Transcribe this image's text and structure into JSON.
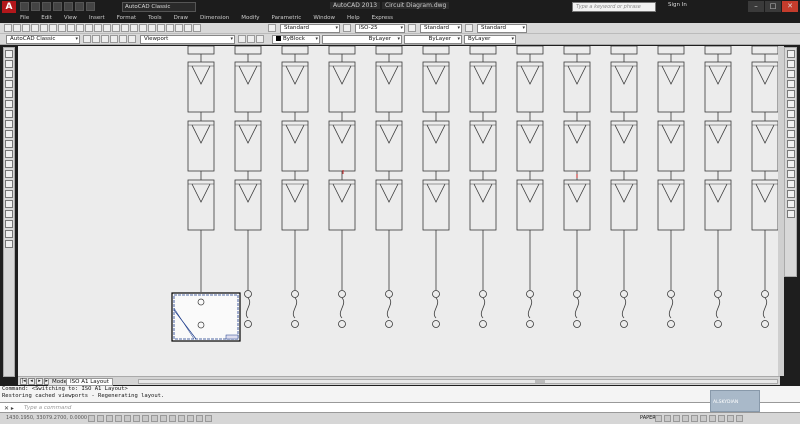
{
  "window": {
    "title_app": "AutoCAD 2013",
    "title_file": "Circuit Diagram.dwg",
    "workspace": "AutoCAD Classic",
    "search_placeholder": "Type a keyword or phrase",
    "signin": "Sign In"
  },
  "menu": [
    "File",
    "Edit",
    "View",
    "Insert",
    "Format",
    "Tools",
    "Draw",
    "Dimension",
    "Modify",
    "Parametric",
    "Window",
    "Help",
    "Express"
  ],
  "toolbar1": {
    "text_style": "Standard",
    "dim_style": "ISO-25",
    "table_style": "Standard",
    "mleader_style": "Standard"
  },
  "toolbar2": {
    "workspace": "AutoCAD Classic",
    "layer": "Viewport",
    "color": "ByBlock",
    "linetype": "ByLayer",
    "lineweight": "ByLayer",
    "plotstyle": "ByLayer"
  },
  "layout_tabs": [
    "Model",
    "ISO A1 Layout"
  ],
  "command_history": [
    "Command:   <Switching to: ISO A1 Layout>",
    "Restoring cached viewports - Regenerating layout."
  ],
  "command_placeholder": "Type a command",
  "coordinates": "1430.1950, 33079.2700, 0.0000",
  "paper_label": "PAPER",
  "watermark_text": "ALSKYDIAN",
  "drawing": {
    "column_count": 13,
    "module_rows": 3,
    "line_color": "#3a3a3a",
    "marker_color": "#cc2222",
    "viewport_border": "#1a3a8a"
  }
}
